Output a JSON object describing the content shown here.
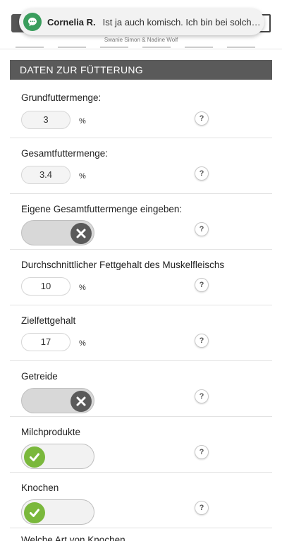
{
  "header": {
    "subtitle": "Swanie Simon & Nadine Wolf"
  },
  "notification": {
    "icon": "chat-bubble-icon",
    "sender": "Cornelia R.",
    "message": "Ist ja auch komisch. Ich bin bei solchen..."
  },
  "section": {
    "title": "DATEN ZUR FÜTTERUNG"
  },
  "fields": {
    "grundfutter": {
      "label": "Grundfuttermenge:",
      "value": "3",
      "unit": "%",
      "help": "?"
    },
    "gesamtfutter": {
      "label": "Gesamtfuttermenge:",
      "value": "3.4",
      "unit": "%",
      "help": "?"
    },
    "eigene": {
      "label": "Eigene Gesamtfuttermenge eingeben:",
      "state": "off",
      "help": "?"
    },
    "fettgehalt": {
      "label": "Durchschnittlicher Fettgehalt des Muskelfleischs",
      "value": "10",
      "unit": "%",
      "help": "?"
    },
    "zielfett": {
      "label": "Zielfettgehalt",
      "value": "17",
      "unit": "%",
      "help": "?"
    },
    "getreide": {
      "label": "Getreide",
      "state": "off",
      "help": "?"
    },
    "milch": {
      "label": "Milchprodukte",
      "state": "on",
      "help": "?"
    },
    "knochen": {
      "label": "Knochen",
      "state": "on",
      "help": "?"
    }
  },
  "cutoff": {
    "label": "Welche Art von Knochen"
  },
  "colors": {
    "section_bg": "#5a5a5a",
    "toggle_on": "#7ab83c",
    "toggle_off_knob": "#5a5a5a",
    "notification_icon": "#3a9d5d"
  }
}
